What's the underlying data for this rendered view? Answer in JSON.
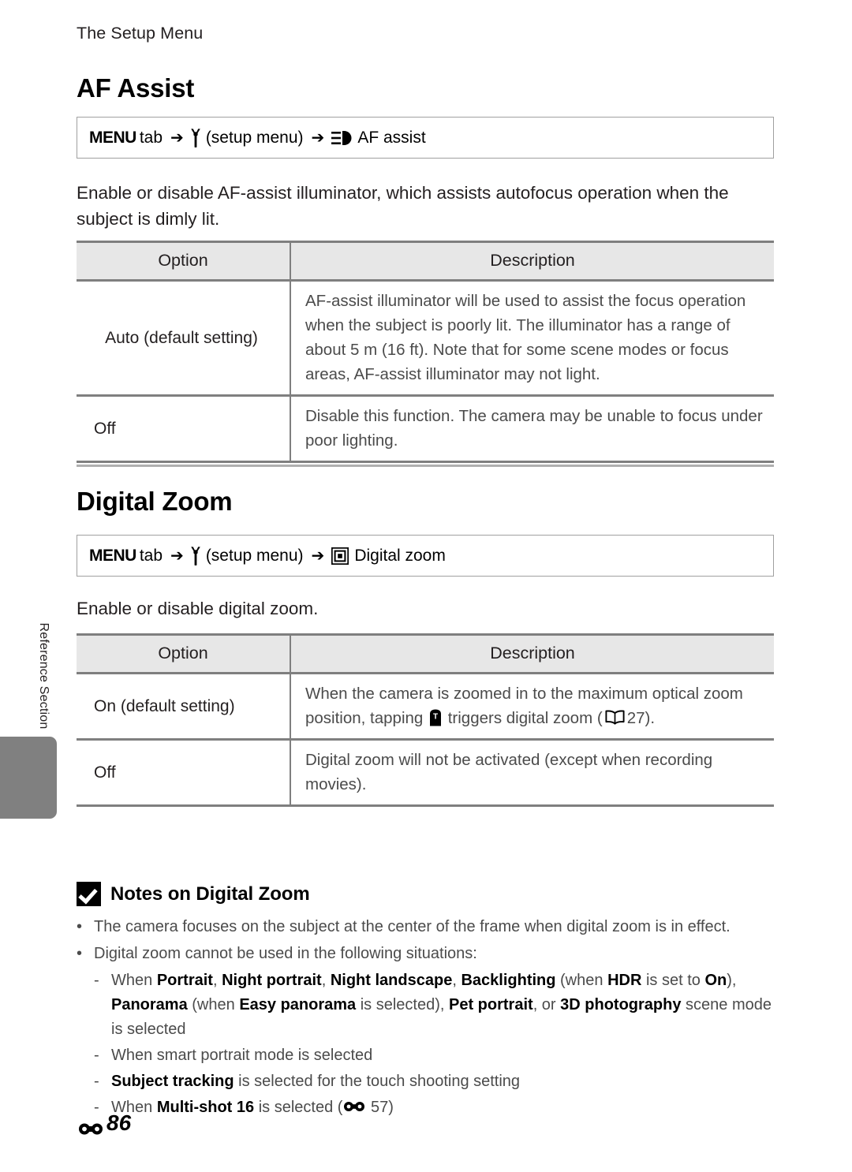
{
  "page": {
    "running_header": "The Setup Menu",
    "side_tab_label": "Reference Section",
    "footer_page": "86"
  },
  "sections": [
    {
      "id": "af-assist",
      "title": "AF Assist",
      "menu_path": {
        "menu_label": "MENU",
        "tab_word": "tab",
        "setup_label": "(setup menu)",
        "item_label": "AF assist",
        "wrench_icon": "wrench-icon",
        "item_icon": "af-assist-illuminator-icon"
      },
      "intro": "Enable or disable AF-assist illuminator, which assists autofocus operation when the subject is dimly lit.",
      "table": {
        "headers": [
          "Option",
          "Description"
        ],
        "rows": [
          {
            "option": "Auto (default setting)",
            "description": "AF-assist illuminator will be used to assist the focus operation when the subject is poorly lit. The illuminator has a range of about 5 m (16 ft). Note that for some scene modes or focus areas, AF-assist illuminator may not light."
          },
          {
            "option": "Off",
            "description": "Disable this function. The camera may be unable to focus under poor lighting."
          }
        ]
      }
    },
    {
      "id": "digital-zoom",
      "title": "Digital Zoom",
      "menu_path": {
        "menu_label": "MENU",
        "tab_word": "tab",
        "setup_label": "(setup menu)",
        "item_label": "Digital zoom",
        "wrench_icon": "wrench-icon",
        "item_icon": "digital-zoom-icon"
      },
      "intro": "Enable or disable digital zoom.",
      "table": {
        "headers": [
          "Option",
          "Description"
        ],
        "rows": [
          {
            "option": "On (default setting)",
            "description_part1": "When the camera is zoomed in to the maximum optical zoom position, tapping",
            "tele_icon": "tele-button-icon",
            "description_part2": "triggers digital zoom (",
            "book_icon": "manual-reference-icon",
            "reference_page": "27",
            "description_part3": ")."
          },
          {
            "option": "Off",
            "description": "Digital zoom will not be activated (except when recording movies)."
          }
        ]
      }
    }
  ],
  "notes": {
    "icon": "check-box-icon",
    "title": "Notes on Digital Zoom",
    "bullets": [
      "The camera focuses on the subject at the center of the frame when digital zoom is in effect.",
      "Digital zoom cannot be used in the following situations:"
    ],
    "sub_items": [
      {
        "parts": [
          {
            "t": "When ",
            "b": false
          },
          {
            "t": "Portrait",
            "b": true
          },
          {
            "t": ", ",
            "b": false
          },
          {
            "t": "Night portrait",
            "b": true
          },
          {
            "t": ", ",
            "b": false
          },
          {
            "t": "Night landscape",
            "b": true
          },
          {
            "t": ", ",
            "b": false
          },
          {
            "t": "Backlighting",
            "b": true
          },
          {
            "t": " (when ",
            "b": false
          },
          {
            "t": "HDR",
            "b": true
          },
          {
            "t": " is set to ",
            "b": false
          },
          {
            "t": "On",
            "b": true
          },
          {
            "t": "), ",
            "b": false
          },
          {
            "t": "Panorama",
            "b": true
          },
          {
            "t": " (when ",
            "b": false
          },
          {
            "t": "Easy panorama",
            "b": true
          },
          {
            "t": " is selected), ",
            "b": false
          },
          {
            "t": "Pet portrait",
            "b": true
          },
          {
            "t": ", or ",
            "b": false
          },
          {
            "t": "3D photography",
            "b": true
          },
          {
            "t": " scene mode is selected",
            "b": false
          }
        ]
      },
      {
        "parts": [
          {
            "t": "When smart portrait mode is selected",
            "b": false
          }
        ]
      },
      {
        "parts": [
          {
            "t": "Subject tracking",
            "b": true
          },
          {
            "t": " is selected for the touch shooting setting",
            "b": false
          }
        ]
      },
      {
        "parts": [
          {
            "t": "When ",
            "b": false
          },
          {
            "t": "Multi-shot 16",
            "b": true
          },
          {
            "t": " is selected (",
            "b": false
          },
          {
            "t": "__BINOC__",
            "b": false
          },
          {
            "t": " 57)",
            "b": false
          }
        ]
      }
    ]
  },
  "symbols": {
    "arrow": "➔",
    "bullet": "•",
    "dash": "-"
  },
  "colors": {
    "text": "#231f20",
    "body_text": "#4b4b4b",
    "table_border": "#7f7f7f",
    "table_header_bg": "#e7e7e7",
    "box_border": "#a0a0a0",
    "side_tab": "#808080"
  }
}
